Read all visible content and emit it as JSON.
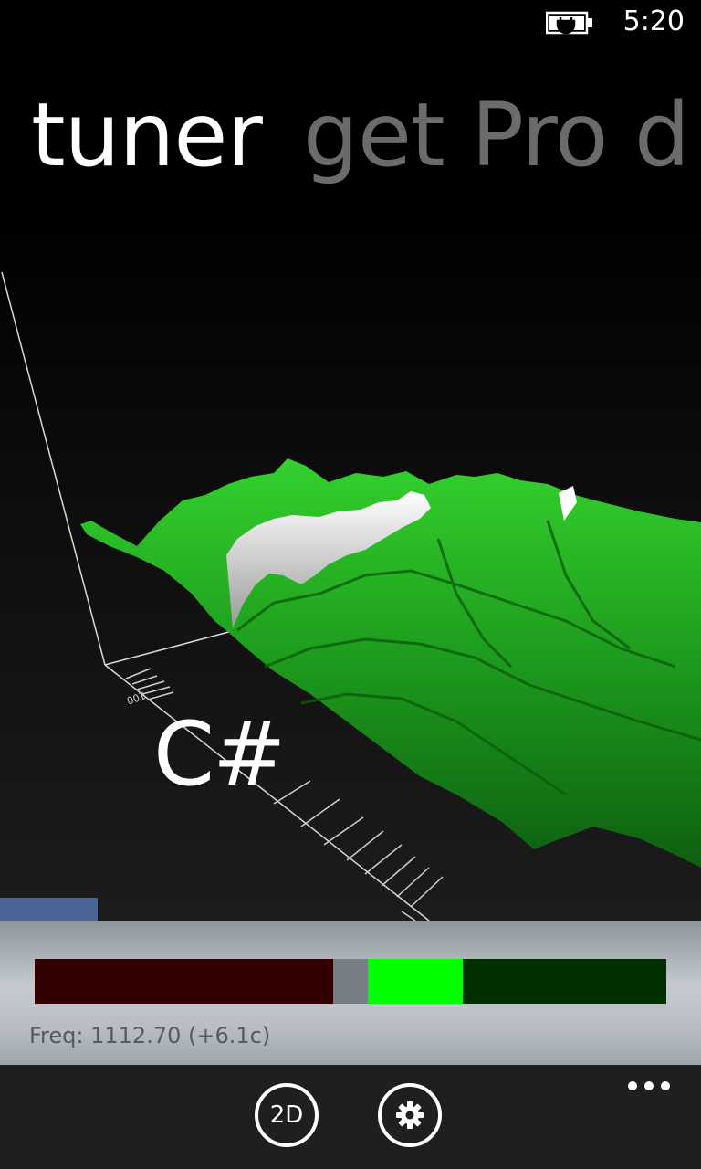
{
  "status_bar": {
    "time": "5:20",
    "battery_icon": "battery-charging-icon"
  },
  "pivot": {
    "active_title": "tuner",
    "next_title": "get Pro d"
  },
  "spectrum": {
    "note": "C#",
    "axis_tick_label": "100",
    "surface_color": "#1fa31f",
    "highlight_color": "#ffffff"
  },
  "tuning_meter": {
    "colors": {
      "flat": "#320000",
      "center": "#767d84",
      "in_tune": "#00ff00",
      "sharp": "#003000"
    },
    "frequency_text": "Freq: 1112.70 (+6.1c)"
  },
  "app_bar": {
    "buttons": [
      {
        "label": "2D"
      },
      {
        "icon": "gear-icon"
      }
    ],
    "more_icon": "ellipsis-icon"
  }
}
